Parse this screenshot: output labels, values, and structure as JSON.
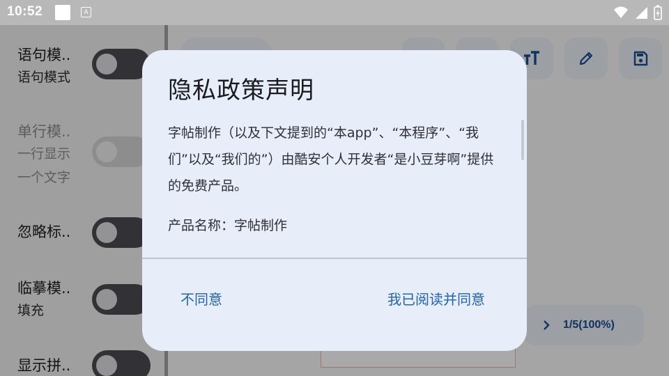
{
  "status_bar": {
    "time": "10:52",
    "notif_icon_label": "A"
  },
  "drawer": {
    "settings": [
      {
        "title": "语句模..",
        "subtitle": "语句模式",
        "enabled": true,
        "on": false
      },
      {
        "title": "单行模..",
        "subtitle": "一行显示",
        "subtitle2": "一个文字",
        "enabled": false,
        "on": false
      },
      {
        "title": "忽略标..",
        "enabled": true,
        "on": false
      },
      {
        "title": "临摹模..",
        "subtitle": "填充",
        "enabled": true,
        "on": false
      },
      {
        "title": "显示拼..",
        "enabled": true,
        "on": false
      }
    ]
  },
  "toolbar": {
    "icons": [
      "text-size-icon",
      "edit-icon",
      "save-icon"
    ]
  },
  "pager": {
    "label": "1/5(100%)"
  },
  "dialog": {
    "title": "隐私政策声明",
    "body": "字帖制作（以及下文提到的“本app”、“本程序”、“我们”以及“我们的”）由酷安个人开发者“是小豆芽啊”提供的免费产品。",
    "product": "产品名称：字帖制作",
    "disagree_label": "不同意",
    "agree_label": "我已阅读并同意"
  },
  "colors": {
    "accent": "#2563a8",
    "dialog_bg": "#e7eefa"
  }
}
